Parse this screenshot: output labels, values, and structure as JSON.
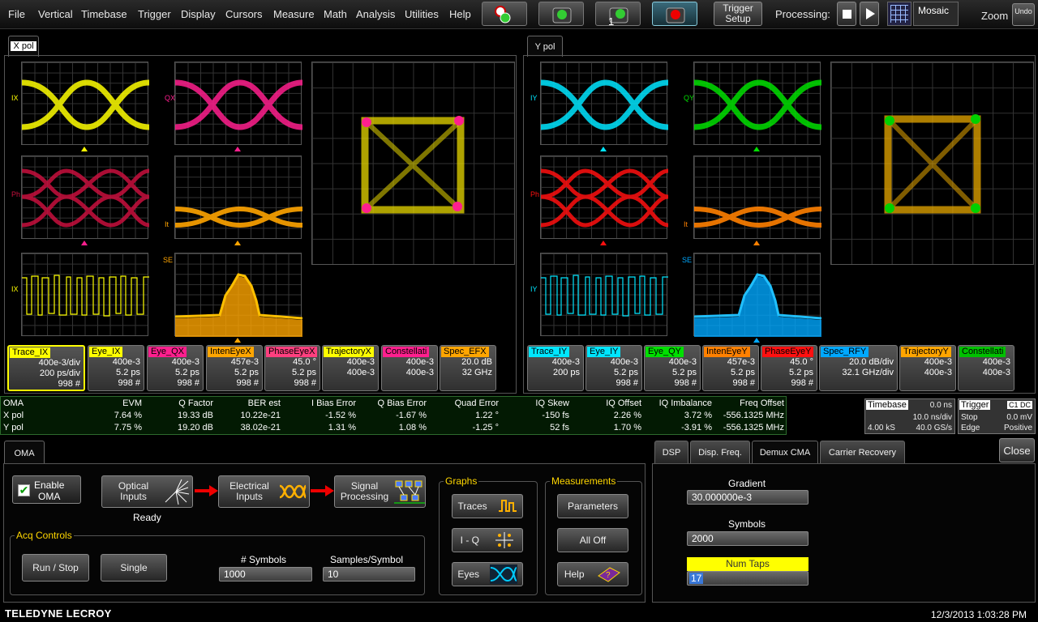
{
  "menu": [
    "File",
    "Vertical",
    "Timebase",
    "Trigger",
    "Display",
    "Cursors",
    "Measure",
    "Math",
    "Analysis",
    "Utilities",
    "Help"
  ],
  "toolbar": {
    "trigger_setup": "Trigger\nSetup",
    "processing": "Processing:",
    "display_mode": "Mosaic",
    "zoom": "Zoom",
    "undo": "Undo"
  },
  "xpol": {
    "tab": "X pol",
    "labels": {
      "ix": "IX",
      "qx": "QX",
      "ph": "Ph",
      "it": "It",
      "se": "SE",
      "ix2": "IX"
    }
  },
  "ypol": {
    "tab": "Y pol",
    "labels": {
      "iy": "IY",
      "qy": "QY",
      "ph": "Ph",
      "it": "It",
      "se": "SE",
      "iy2": "IY"
    }
  },
  "colors": {
    "x_i": "#ffff00",
    "x_q": "#ff1f8e",
    "x_ph": "#c8103e",
    "x_it": "#ffa500",
    "x_traj": "#e8d800",
    "y_i": "#00e6ff",
    "y_q": "#00e000",
    "y_ph": "#ff1010",
    "y_it": "#ff8000",
    "y_spec": "#00a8ff",
    "y_traj": "#e8a800",
    "y_const": "#00c000"
  },
  "descriptors": [
    {
      "name": "Trace_IX",
      "color": "#ffff00",
      "r1": "400e-3/div",
      "r2": "200 ps/div",
      "r3": "998 #",
      "sel": true
    },
    {
      "name": "Eye_IX",
      "color": "#ffff00",
      "r1": "400e-3",
      "r2": "5.2 ps",
      "r3": "998 #"
    },
    {
      "name": "Eye_QX",
      "color": "#ff1f8e",
      "r1": "400e-3",
      "r2": "5.2 ps",
      "r3": "998 #"
    },
    {
      "name": "IntenEyeX",
      "color": "#ffa500",
      "r1": "457e-3",
      "r2": "5.2 ps",
      "r3": "998 #"
    },
    {
      "name": "PhaseEyeX",
      "color": "#ff3f7f",
      "r1": "45.0 °",
      "r2": "5.2 ps",
      "r3": "998 #"
    },
    {
      "name": "TrajectoryX",
      "color": "#ffff00",
      "r1": "400e-3",
      "r2": "400e-3",
      "r3": ""
    },
    {
      "name": "Constellati",
      "color": "#ff1f8e",
      "r1": "400e-3",
      "r2": "400e-3",
      "r3": ""
    },
    {
      "name": "Spec_EFX",
      "color": "#ffa500",
      "r1": "20.0 dB",
      "r2": "32 GHz",
      "r3": ""
    },
    {
      "name": "Trace_IY",
      "color": "#00e6ff",
      "r1": "400e-3",
      "r2": "200 ps",
      "r3": ""
    },
    {
      "name": "Eye_IY",
      "color": "#00e6ff",
      "r1": "400e-3",
      "r2": "5.2 ps",
      "r3": "998 #"
    },
    {
      "name": "Eye_QY",
      "color": "#00e000",
      "r1": "400e-3",
      "r2": "5.2 ps",
      "r3": "998 #"
    },
    {
      "name": "IntenEyeY",
      "color": "#ff8000",
      "r1": "457e-3",
      "r2": "5.2 ps",
      "r3": "998 #"
    },
    {
      "name": "PhaseEyeY",
      "color": "#ff1010",
      "r1": "45.0 °",
      "r2": "5.2 ps",
      "r3": "998 #"
    },
    {
      "name": "Spec_RFY",
      "color": "#00a8ff",
      "r1": "20.0 dB/div",
      "r2": "32.1 GHz/div",
      "r3": ""
    },
    {
      "name": "TrajectoryY",
      "color": "#ffa500",
      "r1": "400e-3",
      "r2": "400e-3",
      "r3": ""
    },
    {
      "name": "Constellati",
      "color": "#00c000",
      "r1": "400e-3",
      "r2": "400e-3",
      "r3": ""
    }
  ],
  "oma_table": {
    "headers": [
      "OMA",
      "EVM",
      "Q Factor",
      "BER est",
      "I Bias Error",
      "Q Bias Error",
      "Quad Error",
      "IQ Skew",
      "IQ Offset",
      "IQ Imbalance",
      "Freq Offset"
    ],
    "rows": [
      [
        "X pol",
        "7.64 %",
        "19.33 dB",
        "10.22e-21",
        "-1.52 %",
        "-1.67 %",
        "1.22 °",
        "-150 fs",
        "2.26 %",
        "3.72 %",
        "-556.1325 MHz"
      ],
      [
        "Y pol",
        "7.75 %",
        "19.20 dB",
        "38.02e-21",
        "1.31 %",
        "1.08 %",
        "-1.25 °",
        "52 fs",
        "1.70 %",
        "-3.91 %",
        "-556.1325 MHz"
      ]
    ]
  },
  "timebase": {
    "title": "Timebase",
    "delay": "0.0 ns",
    "div": "10.0 ns/div",
    "samples": "4.00 kS",
    "rate": "40.0 GS/s"
  },
  "trigger": {
    "title": "Trigger",
    "ch": "C1 DC",
    "mode": "Stop",
    "level": "0.0 mV",
    "type": "Edge",
    "slope": "Positive"
  },
  "oma_panel": {
    "tab": "OMA",
    "enable": "Enable\nOMA",
    "optical": "Optical\nInputs",
    "status": "Ready",
    "electrical": "Electrical\nInputs",
    "signal": "Signal\nProcessing",
    "acq_title": "Acq Controls",
    "run_stop": "Run / Stop",
    "single": "Single",
    "symbols_label": "# Symbols",
    "symbols_value": "1000",
    "sps_label": "Samples/Symbol",
    "sps_value": "10",
    "graphs_title": "Graphs",
    "traces": "Traces",
    "iq": "I - Q",
    "eyes": "Eyes",
    "meas_title": "Measurements",
    "parameters": "Parameters",
    "all_off": "All Off",
    "help": "Help"
  },
  "right_panel": {
    "tabs": [
      "DSP",
      "Disp. Freq.",
      "Demux CMA",
      "Carrier Recovery"
    ],
    "close": "Close",
    "gradient_label": "Gradient",
    "gradient_value": "30.000000e-3",
    "symbols_label": "Symbols",
    "symbols_value": "2000",
    "taps_label": "Num Taps",
    "taps_value": "17"
  },
  "footer": {
    "brand": "TELEDYNE LECROY",
    "datetime": "12/3/2013 1:03:28 PM"
  }
}
